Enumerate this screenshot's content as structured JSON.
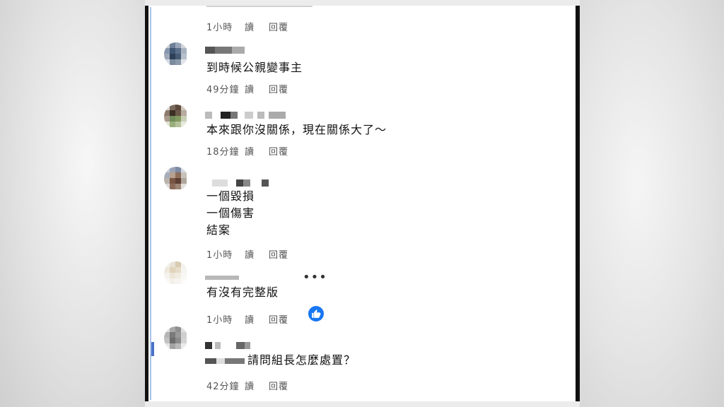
{
  "comments": [
    {
      "text": "",
      "time": "1小時",
      "read": "讀",
      "reply": "回覆"
    },
    {
      "text": "到時候公親變事主",
      "time": "49分鐘",
      "read": "讀",
      "reply": "回覆"
    },
    {
      "text": "本來跟你沒關係，現在關係大了～",
      "time": "18分鐘",
      "read": "讀",
      "reply": "回覆"
    },
    {
      "text": "一個毀損\n一個傷害\n結案",
      "time": "1小時",
      "read": "讀",
      "reply": "回覆"
    },
    {
      "text": "有沒有完整版",
      "time": "1小時",
      "read": "讀",
      "reply": "回覆",
      "more": "•••"
    },
    {
      "text": "請問組長怎麼處置？",
      "time": "42分鐘",
      "read": "讀",
      "reply": "回覆"
    }
  ],
  "icons": {
    "like": "thumbs-up-icon",
    "more": "more-dots-icon"
  },
  "colors": {
    "like_blue": "#1877f2"
  }
}
